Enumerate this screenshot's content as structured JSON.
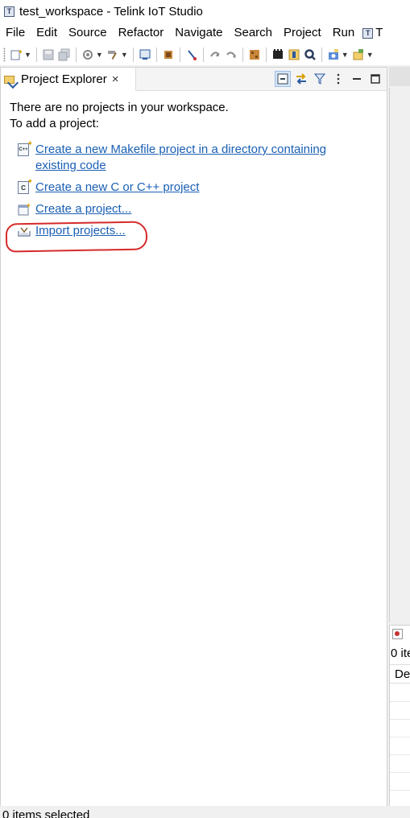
{
  "window": {
    "title": "test_workspace - Telink IoT Studio",
    "app_icon": "T"
  },
  "menubar": {
    "items": [
      "File",
      "Edit",
      "Source",
      "Refactor",
      "Navigate",
      "Search",
      "Project",
      "Run"
    ],
    "overflow_label": "T"
  },
  "toolbar": {
    "icons": [
      "new-icon",
      "save-icon",
      "save-all-icon",
      "settings-icon",
      "build-icon",
      "console-icon",
      "chip-icon",
      "debug-icon",
      "step-icon",
      "step-over-icon",
      "board-icon",
      "flash-icon",
      "bug-icon",
      "search-icon",
      "camera-icon",
      "extension-icon"
    ]
  },
  "project_explorer": {
    "tab_label": "Project Explorer",
    "close_glyph": "×",
    "empty_message_line1": "There are no projects in your workspace.",
    "empty_message_line2": "To add a project:",
    "links": {
      "makefile_line1": "Create a new Makefile project in a directory containing",
      "makefile_line2": "existing code",
      "c_project": "Create a new C or C++ project",
      "create_project": "Create a project...",
      "import_projects": "Import projects..."
    },
    "icons": {
      "makefile": "C++",
      "c": "C"
    }
  },
  "side_panel": {
    "items_count": "0 ite",
    "column_header": "De"
  },
  "statusbar": {
    "text": "0 items selected"
  },
  "colors": {
    "link": "#1a5fb4",
    "annotation": "#d62a2a"
  }
}
